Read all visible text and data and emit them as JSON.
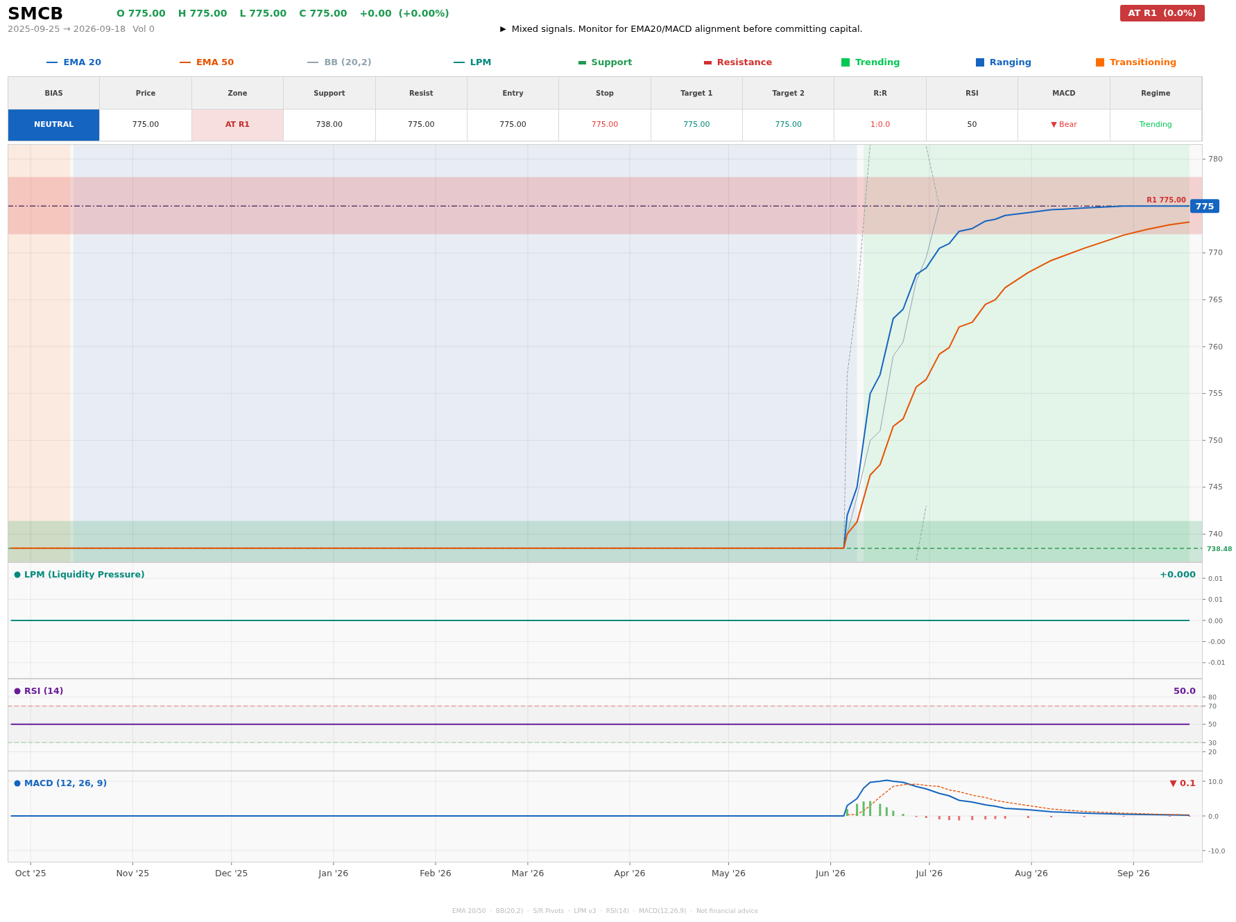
{
  "header": {
    "symbol": "SMCB",
    "ohlc": [
      "O 775.00",
      "H 775.00",
      "L 775.00",
      "C 775.00",
      "+0.00  (+0.00%)"
    ],
    "range": "2025-09-25 → 2026-09-18",
    "volume": "Vol 0",
    "signal_icon": "▶",
    "signal": "Mixed signals. Monitor for EMA20/MACD alignment before committing capital.",
    "badge": "AT R1  (0.0%)"
  },
  "legend": [
    {
      "kind": "line",
      "label": "EMA 20",
      "color": "#1565c0"
    },
    {
      "kind": "line",
      "label": "EMA 50",
      "color": "#e65100"
    },
    {
      "kind": "line",
      "label": "BB (20,2)",
      "color": "#90a4ae"
    },
    {
      "kind": "line",
      "label": "LPM",
      "color": "#00897b"
    },
    {
      "kind": "bar",
      "label": "Support",
      "color": "#1e9a50"
    },
    {
      "kind": "bar",
      "label": "Resistance",
      "color": "#d32f2f"
    },
    {
      "kind": "square",
      "label": "Trending",
      "color": "#00c853"
    },
    {
      "kind": "square",
      "label": "Ranging",
      "color": "#1565c0"
    },
    {
      "kind": "square",
      "label": "Transitioning",
      "color": "#ff6d00"
    }
  ],
  "table": {
    "columns": [
      "BIAS",
      "Price",
      "Zone",
      "Support",
      "Resist",
      "Entry",
      "Stop",
      "Target 1",
      "Target 2",
      "R:R",
      "RSI",
      "MACD",
      "Regime"
    ],
    "cells": [
      {
        "kind": "filled",
        "text": "NEUTRAL",
        "color": "#1565c0"
      },
      {
        "kind": "plain",
        "text": "775.00",
        "color": "#222222"
      },
      {
        "kind": "tinted",
        "text": "AT R1",
        "color": "#c62828"
      },
      {
        "kind": "plain",
        "text": "738.00",
        "color": "#222222"
      },
      {
        "kind": "plain",
        "text": "775.00",
        "color": "#222222"
      },
      {
        "kind": "plain",
        "text": "775.00",
        "color": "#222222"
      },
      {
        "kind": "plain",
        "text": "775.00",
        "color": "#e53935"
      },
      {
        "kind": "plain",
        "text": "775.00",
        "color": "#00897b"
      },
      {
        "kind": "plain",
        "text": "775.00",
        "color": "#00897b"
      },
      {
        "kind": "plain",
        "text": "1:0.0",
        "color": "#e53935"
      },
      {
        "kind": "plain",
        "text": "50",
        "color": "#222222"
      },
      {
        "kind": "plain",
        "text": "▼ Bear",
        "color": "#e53935"
      },
      {
        "kind": "plain",
        "text": "Trending",
        "color": "#00c853"
      }
    ]
  },
  "price_panel": {
    "chart_data": {
      "type": "line",
      "xlim": [
        "2025-09-24",
        "2026-09-22"
      ],
      "ylim": [
        737,
        781.6
      ],
      "x": [
        "2025-09-25",
        "2026-06-05",
        "2026-06-06",
        "2026-06-09",
        "2026-06-13",
        "2026-06-16",
        "2026-06-20",
        "2026-06-23",
        "2026-06-27",
        "2026-06-30",
        "2026-07-04",
        "2026-07-07",
        "2026-07-10",
        "2026-07-14",
        "2026-07-18",
        "2026-07-21",
        "2026-07-24",
        "2026-07-31",
        "2026-08-07",
        "2026-08-17",
        "2026-08-29",
        "2026-09-05",
        "2026-09-12",
        "2026-09-18"
      ],
      "series": [
        {
          "color": "#90a4ae",
          "line_style": "dashed",
          "values": [
            null,
            738.5,
            757,
            765,
            781.6,
            null,
            null,
            null,
            null,
            781.4,
            775,
            null,
            null,
            null,
            null,
            null,
            null,
            null,
            null,
            null,
            null,
            null,
            null,
            null
          ]
        },
        {
          "color": "#90a4ae",
          "line_style": "dashed",
          "values": [
            null,
            null,
            null,
            null,
            null,
            null,
            null,
            null,
            737.2,
            743,
            null,
            null,
            null,
            null,
            null,
            null,
            null,
            null,
            null,
            null,
            null,
            null,
            null,
            null
          ]
        },
        {
          "color": "#90a4ae",
          "values": [
            null,
            738.5,
            740,
            744,
            750,
            751,
            759,
            760.5,
            767,
            769.5,
            775,
            null,
            null,
            null,
            null,
            null,
            null,
            null,
            null,
            null,
            null,
            null,
            null,
            null
          ]
        },
        {
          "color": "#1565c0",
          "values": [
            null,
            738.5,
            742,
            745,
            755,
            757,
            763,
            764,
            767.7,
            768.4,
            770.5,
            771,
            772.3,
            772.6,
            773.4,
            773.6,
            774,
            774.3,
            774.6,
            774.8,
            775,
            775,
            775,
            775
          ]
        },
        {
          "color": "#e65100",
          "values": [
            738.5,
            738.5,
            740,
            741.3,
            746.3,
            747.4,
            751.5,
            752.3,
            755.7,
            756.5,
            759.2,
            759.9,
            762.1,
            762.6,
            764.5,
            765,
            766.3,
            767.9,
            769.2,
            770.5,
            771.9,
            772.5,
            773,
            773.3
          ]
        }
      ],
      "grid": true,
      "yticks": [
        740,
        745,
        750,
        755,
        760,
        765,
        770,
        780
      ],
      "bands": [
        {
          "axis": "x",
          "from": "2025-09-24",
          "to": "2025-10-13",
          "color": "#fbeadf"
        },
        {
          "axis": "x",
          "from": "2025-10-14",
          "to": "2026-06-09",
          "color": "#e8edf4"
        },
        {
          "axis": "x",
          "from": "2026-06-11",
          "to": "2026-09-18",
          "color": "#e3f4e9"
        },
        {
          "axis": "y",
          "from": 772,
          "to": 778.1,
          "color": "#e57373"
        },
        {
          "axis": "y",
          "from": 737,
          "to": 741.4,
          "color": "#66bb8a"
        }
      ],
      "ref_lines": [
        {
          "axis": "y",
          "value": 775,
          "label": "R1 775.00",
          "color": "#5e3a6a"
        },
        {
          "axis": "y",
          "value": 738.48,
          "label": "738.48",
          "color": "#2e9e5e"
        }
      ],
      "annotations": [
        "775"
      ]
    }
  },
  "lpm_panel": {
    "title": "LPM (Liquidity Pressure)",
    "value": "+0.000",
    "color": "#00897b",
    "chart_data": {
      "type": "line",
      "xlim": [
        "2025-09-24",
        "2026-09-22"
      ],
      "ylim": [
        -0.0138,
        0.0138
      ],
      "x": [
        "2025-09-25",
        "2026-09-18"
      ],
      "grid": true,
      "series": [
        {
          "color": "#00897b",
          "values": [
            0,
            0
          ]
        }
      ],
      "yticks": [
        {
          "value": 0.01,
          "label": "0.01"
        },
        {
          "value": 0.005,
          "label": "0.01"
        },
        {
          "value": 0,
          "label": "0.00"
        },
        {
          "value": -0.005,
          "label": "-0.00"
        },
        {
          "value": -0.01,
          "label": "-0.01"
        }
      ]
    }
  },
  "rsi_panel": {
    "title": "RSI (14)",
    "value": "50.0",
    "color": "#6a1b9a",
    "chart_data": {
      "type": "line",
      "xlim": [
        "2025-09-24",
        "2026-09-22"
      ],
      "ylim": [
        -1,
        100
      ],
      "x": [
        "2025-09-25",
        "2026-09-18"
      ],
      "grid": true,
      "series": [
        {
          "color": "#6a1b9a",
          "values": [
            50,
            50
          ]
        }
      ],
      "yticks": [
        80,
        70,
        50,
        30,
        20
      ],
      "bands": [
        {
          "axis": "y",
          "from": 30,
          "to": 70,
          "color": "#e0e0e0"
        }
      ],
      "ref_lines": [
        {
          "axis": "y",
          "value": 70,
          "color": "#ef9a9a"
        },
        {
          "axis": "y",
          "value": 30,
          "color": "#a5d6a7"
        }
      ]
    }
  },
  "macd_panel": {
    "title": "MACD (12, 26, 9)",
    "value": "▼ 0.1",
    "color": "#d32f2f",
    "chart_data": {
      "type": "line",
      "xlim": [
        "2025-09-24",
        "2026-09-22"
      ],
      "ylim": [
        -13.4,
        13
      ],
      "x": [
        "2025-09-25",
        "2026-06-05",
        "2026-06-06",
        "2026-06-09",
        "2026-06-11",
        "2026-06-13",
        "2026-06-16",
        "2026-06-18",
        "2026-06-20",
        "2026-06-23",
        "2026-06-27",
        "2026-06-30",
        "2026-07-04",
        "2026-07-07",
        "2026-07-10",
        "2026-07-14",
        "2026-07-18",
        "2026-07-21",
        "2026-07-24",
        "2026-07-31",
        "2026-08-07",
        "2026-08-17",
        "2026-08-29",
        "2026-09-12",
        "2026-09-18"
      ],
      "series": [
        {
          "type": "line",
          "color": "#1565c0",
          "values": [
            0,
            0,
            3,
            5,
            8,
            9.7,
            10,
            10.3,
            10,
            9.7,
            8.5,
            7.8,
            6.5,
            5.8,
            4.5,
            4,
            3.2,
            2.8,
            2.2,
            1.8,
            1.2,
            0.8,
            0.5,
            0.3,
            0.2
          ]
        },
        {
          "type": "line",
          "color": "#e65100",
          "line_style": "dashed",
          "values": [
            null,
            null,
            0.3,
            0.5,
            1.5,
            3,
            5.5,
            7,
            8.5,
            9,
            9.2,
            8.8,
            8.5,
            7.5,
            7,
            6,
            5.3,
            4.5,
            4,
            3,
            2,
            1.3,
            0.8,
            0.4,
            0.3
          ]
        },
        {
          "type": "bar",
          "color": "#66bb6a",
          "values": [
            null,
            null,
            2,
            3.5,
            4.2,
            4.3,
            3.5,
            2.5,
            1.5,
            0.6,
            null,
            null,
            null,
            null,
            null,
            null,
            null,
            null,
            null,
            null,
            null,
            null,
            null,
            null,
            null
          ]
        },
        {
          "type": "bar",
          "color": "#e57373",
          "values": [
            null,
            null,
            null,
            null,
            null,
            null,
            null,
            null,
            null,
            null,
            -0.3,
            -0.6,
            -1,
            -1.2,
            -1.3,
            -1.2,
            -1,
            -0.9,
            -0.8,
            -0.6,
            -0.4,
            -0.3,
            -0.2,
            -0.1,
            -0.1
          ]
        }
      ],
      "grid": true,
      "xticks": [
        {
          "value": "2025-10-01",
          "label": "Oct '25"
        },
        {
          "value": "2025-11-01",
          "label": "Nov '25"
        },
        {
          "value": "2025-12-01",
          "label": "Dec '25"
        },
        {
          "value": "2026-01-01",
          "label": "Jan '26"
        },
        {
          "value": "2026-02-01",
          "label": "Feb '26"
        },
        {
          "value": "2026-03-01",
          "label": "Mar '26"
        },
        {
          "value": "2026-04-01",
          "label": "Apr '26"
        },
        {
          "value": "2026-05-01",
          "label": "May '26"
        },
        {
          "value": "2026-06-01",
          "label": "Jun '26"
        },
        {
          "value": "2026-07-01",
          "label": "Jul '26"
        },
        {
          "value": "2026-08-01",
          "label": "Aug '26"
        },
        {
          "value": "2026-09-01",
          "label": "Sep '26"
        }
      ],
      "yticks": [
        {
          "value": 10,
          "label": "10.0"
        },
        {
          "value": 0,
          "label": "0.0"
        },
        {
          "value": -10,
          "label": "-10.0"
        }
      ]
    }
  },
  "footer": "EMA 20/50  ·  BB(20,2)  ·  S/R Pivots  ·  LPM v3  ·  RSI(14)  ·  MACD(12,26,9)  ·  Not financial advice"
}
